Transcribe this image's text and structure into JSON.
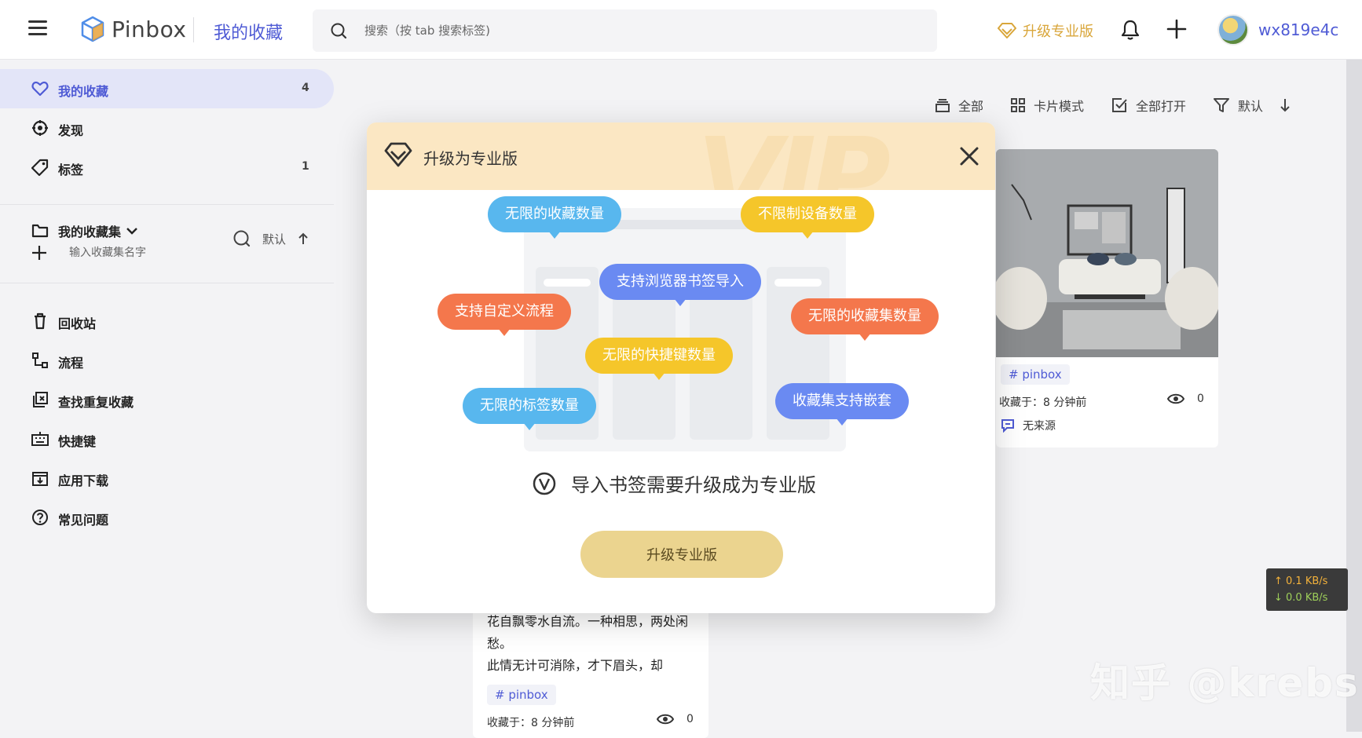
{
  "header": {
    "logo_text": "Pinbox",
    "section_title": "我的收藏",
    "search_placeholder": "搜索（按 tab 搜索标签)",
    "upgrade_label": "升级专业版",
    "username": "wx819e4c"
  },
  "sidebar": {
    "items": [
      {
        "label": "我的收藏",
        "count": "4",
        "icon": "heart-icon"
      },
      {
        "label": "发现",
        "count": "",
        "icon": "compass-icon"
      },
      {
        "label": "标签",
        "count": "1",
        "icon": "tag-icon"
      }
    ],
    "collections": {
      "title": "我的收藏集",
      "sort_label": "默认",
      "new_placeholder": "输入收藏集名字"
    },
    "bottom_items": [
      {
        "label": "回收站",
        "icon": "trash-icon"
      },
      {
        "label": "流程",
        "icon": "flow-icon"
      },
      {
        "label": "查找重复收藏",
        "icon": "duplicate-icon"
      },
      {
        "label": "快捷键",
        "icon": "keyboard-icon"
      },
      {
        "label": "应用下载",
        "icon": "download-icon"
      },
      {
        "label": "常见问题",
        "icon": "help-icon"
      }
    ]
  },
  "toolbar": {
    "all_label": "全部",
    "view_label": "卡片模式",
    "open_all_label": "全部打开",
    "sort_label": "默认"
  },
  "cards": [
    {
      "tag": "# pinbox",
      "saved": "收藏于：8 分钟前",
      "views": "0",
      "source": "无来源"
    },
    {
      "poem": "花自飘零水自流。一种相思，两处闲愁。\n此情无计可消除，才下眉头，却",
      "tag": "# pinbox",
      "saved": "收藏于：8 分钟前",
      "views": "0"
    }
  ],
  "modal": {
    "title": "升级为专业版",
    "features": [
      "无限的收藏数量",
      "不限制设备数量",
      "支持浏览器书签导入",
      "支持自定义流程",
      "无限的收藏集数量",
      "无限的快捷键数量",
      "无限的标签数量",
      "收藏集支持嵌套"
    ],
    "message": "导入书签需要升级成为专业版",
    "button_label": "升级专业版"
  },
  "net_speed": {
    "up": "↑ 0.1 KB/s",
    "down": "↓ 0.0 KB/s"
  },
  "watermark": "知乎 @krebs",
  "colors": {
    "accent": "#4f5bd5",
    "gold": "#d9a63a",
    "button": "#ebd48f"
  }
}
